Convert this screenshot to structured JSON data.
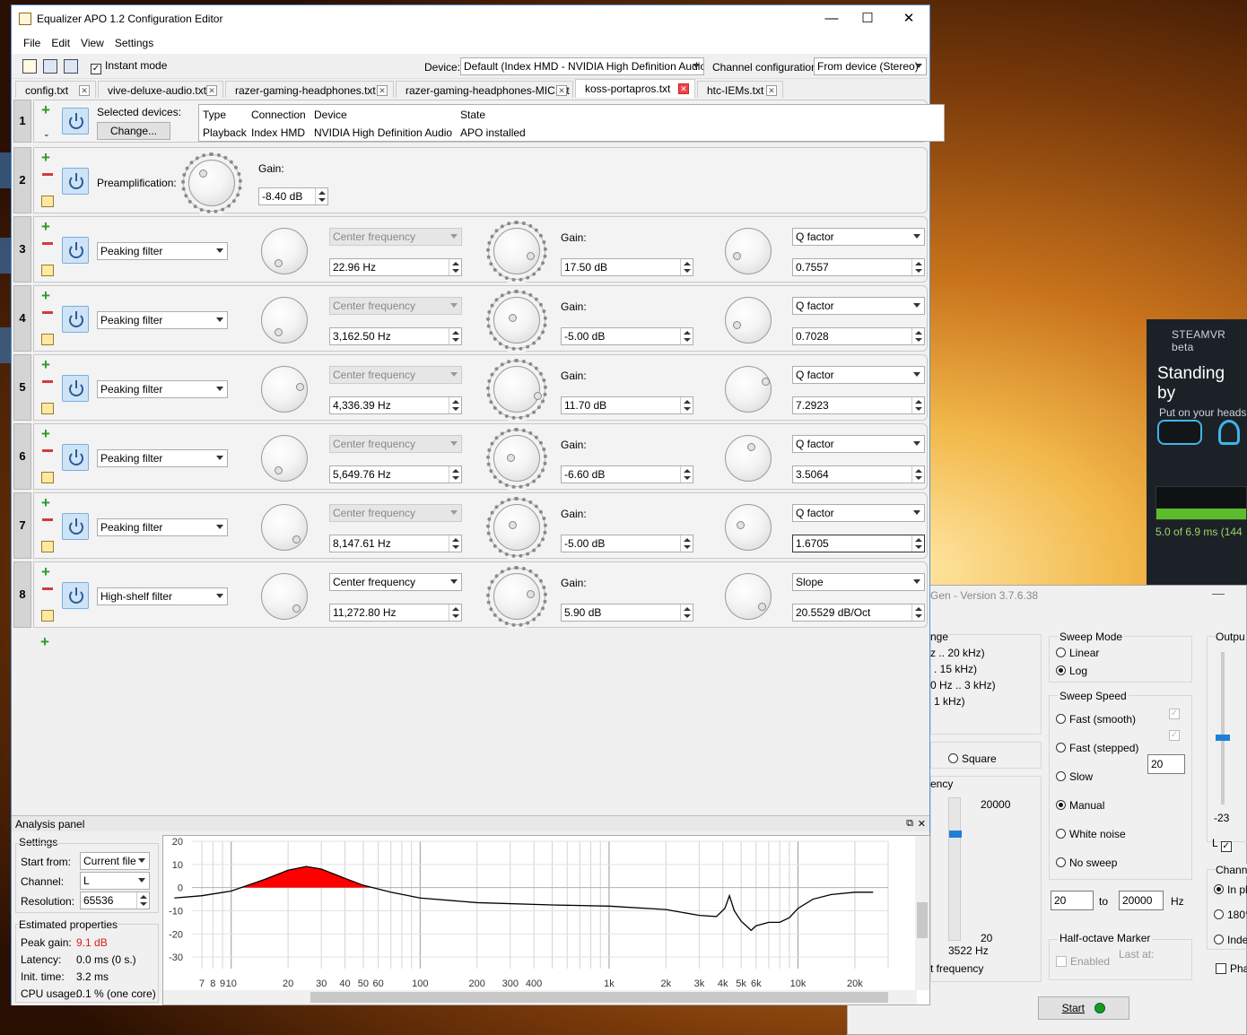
{
  "window": {
    "title": "Equalizer APO 1.2 Configuration Editor",
    "minimize": "—",
    "maximize": "☐",
    "close": "✕"
  },
  "menu": [
    "File",
    "Edit",
    "View",
    "Settings"
  ],
  "toolbar": {
    "instant_mode_label": "Instant mode",
    "instant_mode_checked": true,
    "device_label": "Device:",
    "device_value": "Default (Index HMD - NVIDIA High Definition Audio)",
    "channel_label": "Channel configuration:",
    "channel_value": "From device (Stereo)"
  },
  "tabs": [
    {
      "label": "config.txt",
      "active": false
    },
    {
      "label": "vive-deluxe-audio.txt",
      "active": false
    },
    {
      "label": "razer-gaming-headphones.txt",
      "active": false
    },
    {
      "label": "razer-gaming-headphones-MIC.txt",
      "active": false
    },
    {
      "label": "koss-portapros.txt",
      "active": true
    },
    {
      "label": "htc-IEMs.txt",
      "active": false
    }
  ],
  "device_row": {
    "num": "1",
    "selected_label": "Selected devices:",
    "change_button": "Change...",
    "headers": [
      "Type",
      "Connection",
      "Device",
      "State"
    ],
    "values": [
      "Playback",
      "Index HMD",
      "NVIDIA High Definition Audio",
      "APO installed"
    ]
  },
  "preamp_row": {
    "num": "2",
    "label": "Preamplification:",
    "gain_label": "Gain:",
    "gain_value": "-8.40 dB"
  },
  "filter_rows": [
    {
      "num": "3",
      "type": "Peaking filter",
      "freq_label": "Center frequency",
      "freq_value": "22.96 Hz",
      "gain_label": "Gain:",
      "gain_value": "17.50 dB",
      "q_label": "Q factor",
      "q_value": "0.7557"
    },
    {
      "num": "4",
      "type": "Peaking filter",
      "freq_label": "Center frequency",
      "freq_value": "3,162.50 Hz",
      "gain_label": "Gain:",
      "gain_value": "-5.00 dB",
      "q_label": "Q factor",
      "q_value": "0.7028"
    },
    {
      "num": "5",
      "type": "Peaking filter",
      "freq_label": "Center frequency",
      "freq_value": "4,336.39 Hz",
      "gain_label": "Gain:",
      "gain_value": "11.70 dB",
      "q_label": "Q factor",
      "q_value": "7.2923"
    },
    {
      "num": "6",
      "type": "Peaking filter",
      "freq_label": "Center frequency",
      "freq_value": "5,649.76 Hz",
      "gain_label": "Gain:",
      "gain_value": "-6.60 dB",
      "q_label": "Q factor",
      "q_value": "3.5064"
    },
    {
      "num": "7",
      "type": "Peaking filter",
      "freq_label": "Center frequency",
      "freq_value": "8,147.61 Hz",
      "gain_label": "Gain:",
      "gain_value": "-5.00 dB",
      "q_label": "Q factor",
      "q_value": "1.6705"
    },
    {
      "num": "8",
      "type": "High-shelf filter",
      "freq_label": "Center frequency",
      "freq_value": "11,272.80 Hz",
      "gain_label": "Gain:",
      "gain_value": "5.90 dB",
      "q_label": "Slope",
      "q_value": "20.5529 dB/Oct"
    }
  ],
  "analysis": {
    "title": "Analysis panel",
    "settings_title": "Settings",
    "start_from_label": "Start from:",
    "start_from_value": "Current file",
    "channel_label": "Channel:",
    "channel_value": "L",
    "resolution_label": "Resolution:",
    "resolution_value": "65536",
    "estimated_title": "Estimated properties",
    "peak_gain_label": "Peak gain:",
    "peak_gain_value": "9.1 dB",
    "latency_label": "Latency:",
    "latency_value": "0.0 ms (0 s.)",
    "init_time_label": "Init. time:",
    "init_time_value": "3.2 ms",
    "cpu_label": "CPU usage:",
    "cpu_value": "0.1 % (one core)"
  },
  "chart_data": {
    "type": "line",
    "x_scale": "log",
    "ylim": [
      -35,
      20
    ],
    "y_ticks": [
      "20",
      "10",
      "0",
      "-10",
      "-20",
      "-30"
    ],
    "x_ticks": [
      "7",
      "8",
      "9",
      "10",
      "20",
      "30",
      "40",
      "50",
      "60",
      "100",
      "200",
      "300",
      "400",
      "1k",
      "2k",
      "3k",
      "4k",
      "5k",
      "6k",
      "10k",
      "20k"
    ],
    "x_tick_values": [
      7,
      8,
      9,
      10,
      20,
      30,
      40,
      50,
      60,
      100,
      200,
      300,
      400,
      1000,
      2000,
      3000,
      4000,
      5000,
      6000,
      10000,
      20000
    ],
    "series": [
      {
        "color": "#000000",
        "positive_fill": "#ff0000",
        "x": [
          5,
          7,
          10,
          15,
          20,
          25,
          30,
          40,
          50,
          70,
          100,
          200,
          500,
          1000,
          2000,
          3000,
          3700,
          4100,
          4336,
          4600,
          5000,
          5400,
          5650,
          6000,
          7000,
          8000,
          9000,
          10000,
          12000,
          15000,
          20000,
          25000
        ],
        "y": [
          -4.5,
          -3.5,
          -1.5,
          3.5,
          7.5,
          9.1,
          8.0,
          4.0,
          1.0,
          -2.0,
          -4.5,
          -6.5,
          -7.5,
          -8.0,
          -9.5,
          -12.0,
          -12.5,
          -9.0,
          -3.5,
          -10.0,
          -14.5,
          -17.0,
          -18.5,
          -16.5,
          -15.0,
          -15.0,
          -13.0,
          -9.0,
          -5.0,
          -3.0,
          -2.0,
          -2.0
        ]
      }
    ]
  },
  "siggen": {
    "title_fragment": "Gen - Version 3.7.6.38",
    "range_items": [
      "nge",
      "z .. 20 kHz)",
      ". 15 kHz)",
      "0 Hz .. 3 kHz)",
      "1 kHz)"
    ],
    "square_label": "Square",
    "freq_fragment": "ency",
    "freq_max": "20000",
    "freq_min": "20",
    "freq_current": "3522 Hz",
    "freq_footer": "t frequency",
    "sweep_mode_title": "Sweep Mode",
    "sweep_linear": "Linear",
    "sweep_log": "Log",
    "sweep_speed_title": "Sweep Speed",
    "speed_options": [
      "Fast (smooth)",
      "Fast (stepped)",
      "Slow",
      "Manual",
      "White noise",
      "No sweep"
    ],
    "step_value": "20",
    "from_value": "20",
    "to_label": "to",
    "to_value": "20000",
    "hz_label": "Hz",
    "half_octave_title": "Half-octave Marker",
    "half_octave_enabled": "Enabled",
    "last_at": "Last at:",
    "output_title": "Outpu",
    "output_level": "-23",
    "l_label": "L",
    "channel_title": "Chann",
    "channel_opts": [
      "In ph",
      "180°",
      "Inde"
    ],
    "phase_label": "Pha",
    "start_button": "Start"
  },
  "steamvr": {
    "header": "STEAMVR beta",
    "title": "Standing by",
    "subtitle": "Put on your heads",
    "timing": "5.0 of 6.9 ms (144"
  }
}
